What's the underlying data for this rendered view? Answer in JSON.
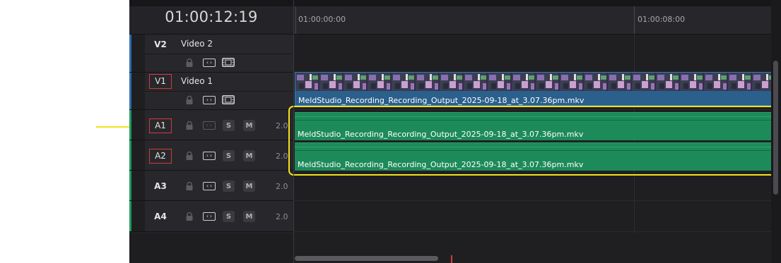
{
  "timecode": "01:00:12:19",
  "ruler": {
    "labels": [
      "01:00:00:00",
      "01:00:08:00"
    ]
  },
  "tracks": [
    {
      "id": "V2",
      "name": "Video 2",
      "kind": "video",
      "color": "#2f6db0"
    },
    {
      "id": "V1",
      "name": "Video 1",
      "kind": "video",
      "color": "#2f6db0"
    },
    {
      "id": "A1",
      "name": "",
      "kind": "audio",
      "color": "#1f9a5e",
      "solo": "S",
      "mute": "M",
      "volume": "2.0"
    },
    {
      "id": "A2",
      "name": "",
      "kind": "audio",
      "color": "#1f9a5e",
      "solo": "S",
      "mute": "M",
      "volume": "2.0"
    },
    {
      "id": "A3",
      "name": "",
      "kind": "audio",
      "color": "#1f9a5e",
      "solo": "S",
      "mute": "M",
      "volume": "2.0"
    },
    {
      "id": "A4",
      "name": "",
      "kind": "audio",
      "color": "#1f9a5e",
      "solo": "S",
      "mute": "M",
      "volume": "2.0"
    }
  ],
  "clips": {
    "video_v1": "MeldStudio_Recording_Recording_Output_2025-09-18_at_3.07.36pm.mkv",
    "audio_a1": "MeldStudio_Recording_Recording_Output_2025-09-18_at_3.07.36pm.mkv",
    "audio_a2": "MeldStudio_Recording_Recording_Output_2025-09-18_at_3.07.36pm.mkv"
  },
  "colors": {
    "video_clip": "#2b5f8c",
    "audio_clip": "#1d8a5a",
    "highlight": "#f2e21a",
    "playhead": "#d63b3b"
  }
}
